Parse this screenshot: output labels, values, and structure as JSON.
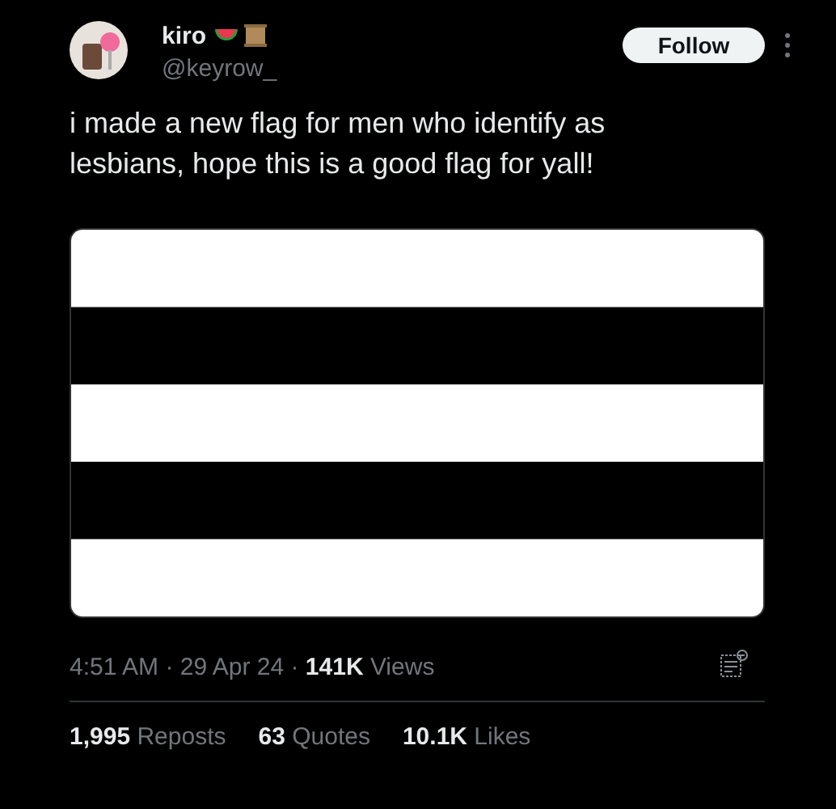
{
  "author": {
    "name": "kiro",
    "handle": "@keyrow_"
  },
  "follow_button": "Follow",
  "text": "i made a new flag for men who identify as lesbians, hope this is a good flag for yall!",
  "meta": "4:51 AM · 29 Apr 24 · **141K** Views",
  "stats": [
    {
      "text": "**1,995** Reposts"
    },
    {
      "text": "**63** Quotes"
    },
    {
      "text": "**10.1K** Likes"
    }
  ]
}
